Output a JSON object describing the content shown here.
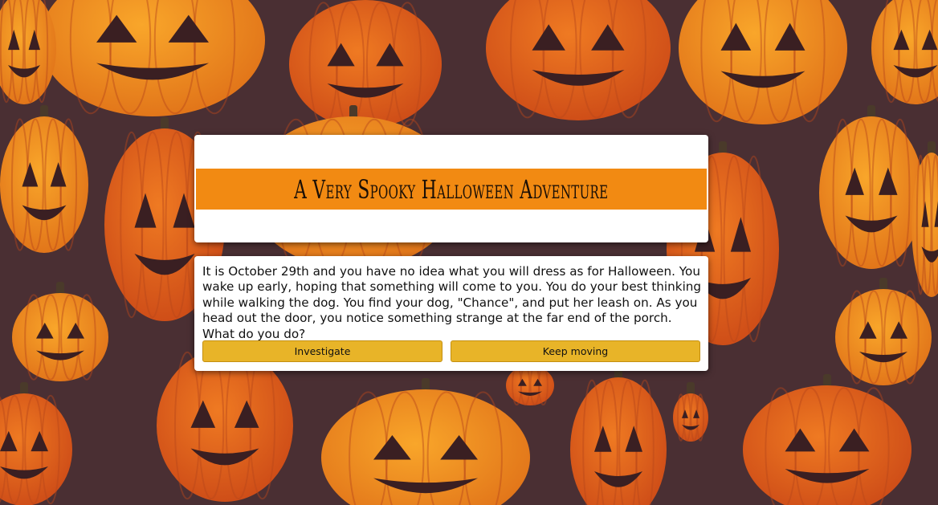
{
  "page": {
    "title": "A Very Spooky Halloween Adventure"
  },
  "story": {
    "text": "It is October 29th and you have no idea what you will dress as for Halloween. You wake up early, hoping that something will come to you. You do your best thinking while walking the dog. You find your dog, \"Chance\", and put her leash on. As you head out the door, you notice something strange at the far end of the porch. What do you do?"
  },
  "choices": [
    {
      "label": "Investigate"
    },
    {
      "label": "Keep moving"
    }
  ],
  "colors": {
    "background": "#4a2f33",
    "title_band": "#f28a12",
    "button": "#e8b428",
    "pumpkin_light": "#f59a1f",
    "pumpkin_dark": "#d9581a"
  },
  "background_icon": "jack-o-lantern-pattern"
}
